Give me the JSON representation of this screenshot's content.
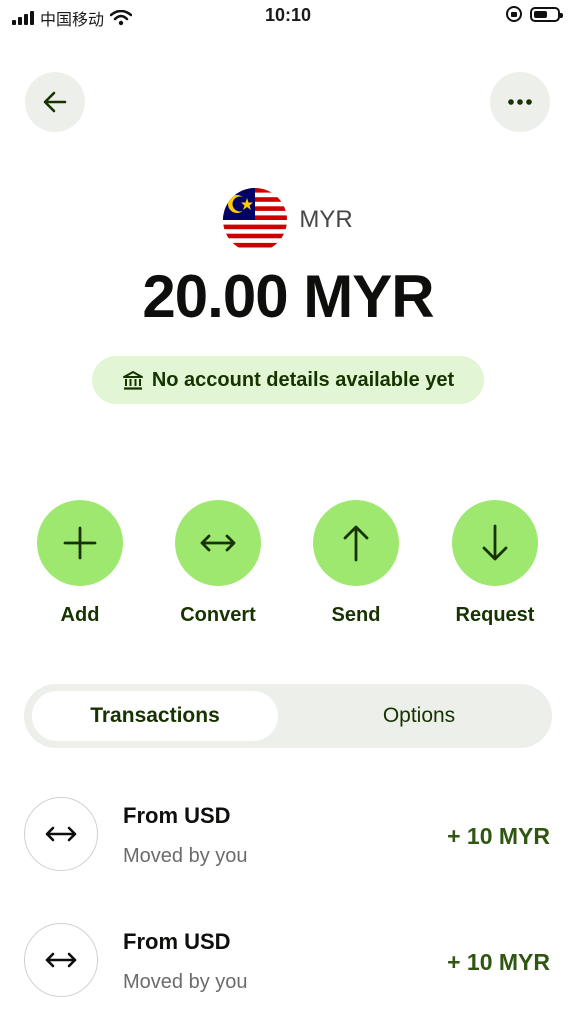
{
  "status_bar": {
    "carrier": "中国移动",
    "time": "10:10"
  },
  "header": {
    "back_icon": "arrow-left-icon",
    "more_icon": "more-horizontal-icon"
  },
  "account": {
    "currency_code": "MYR",
    "flag_icon": "malaysia-flag-icon",
    "balance": "20.00 MYR",
    "notice": "No account details available yet",
    "notice_icon": "bank-icon"
  },
  "actions": [
    {
      "label": "Add",
      "icon": "plus-icon"
    },
    {
      "label": "Convert",
      "icon": "arrows-horizontal-icon"
    },
    {
      "label": "Send",
      "icon": "arrow-up-icon"
    },
    {
      "label": "Request",
      "icon": "arrow-down-icon"
    }
  ],
  "tabs": [
    {
      "label": "Transactions",
      "active": true
    },
    {
      "label": "Options",
      "active": false
    }
  ],
  "transactions": [
    {
      "title": "From USD",
      "subtitle": "Moved by you",
      "amount": "+ 10 MYR",
      "icon": "arrows-horizontal-icon"
    },
    {
      "title": "From USD",
      "subtitle": "Moved by you",
      "amount": "+ 10 MYR",
      "icon": "arrows-horizontal-icon"
    }
  ],
  "colors": {
    "accent_green": "#9fe870",
    "dark_green": "#163300",
    "pill_bg": "#e2f6d5",
    "amount_green": "#2f5711"
  }
}
